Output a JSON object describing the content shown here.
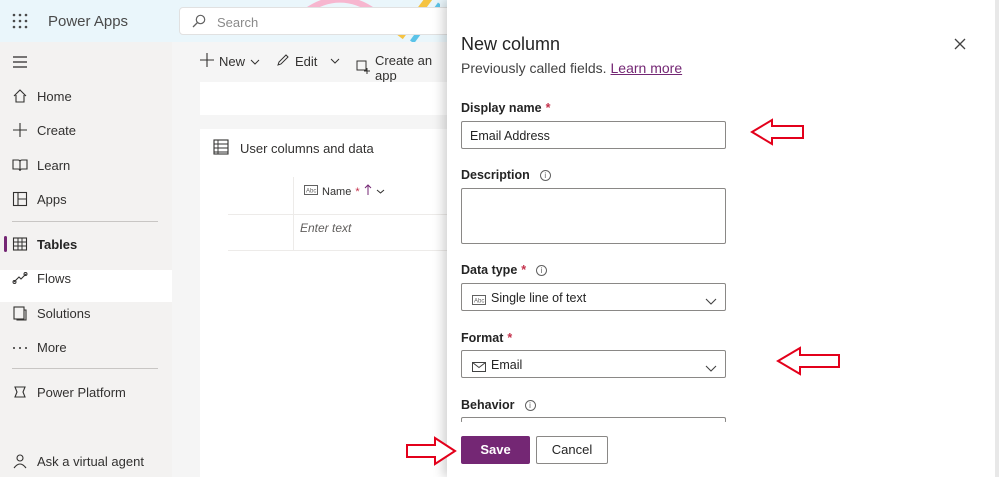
{
  "app": {
    "name": "Power Apps"
  },
  "search": {
    "placeholder": "Search"
  },
  "nav": {
    "items": [
      {
        "label": "Home",
        "icon": "home-icon"
      },
      {
        "label": "Create",
        "icon": "plus-icon"
      },
      {
        "label": "Learn",
        "icon": "book-icon"
      },
      {
        "label": "Apps",
        "icon": "apps-icon"
      },
      {
        "label": "Tables",
        "icon": "table-icon",
        "active": true
      },
      {
        "label": "Flows",
        "icon": "flow-icon"
      },
      {
        "label": "Solutions",
        "icon": "solutions-icon"
      },
      {
        "label": "More",
        "icon": "more-icon"
      },
      {
        "label": "Power Platform",
        "icon": "power-platform-icon"
      },
      {
        "label": "Ask a virtual agent",
        "icon": "agent-icon"
      }
    ]
  },
  "commandbar": {
    "new_label": "New",
    "edit_label": "Edit",
    "create_app_label": "Create an app"
  },
  "table_card": {
    "title": "User columns and data",
    "column_header": "Name",
    "cell_placeholder": "Enter text"
  },
  "panel": {
    "title": "New column",
    "subtitle": "Previously called fields.",
    "learn_more": "Learn more",
    "display_name": {
      "label": "Display name",
      "value": "Email Address"
    },
    "description": {
      "label": "Description",
      "value": ""
    },
    "data_type": {
      "label": "Data type",
      "value": "Single line of text"
    },
    "format": {
      "label": "Format",
      "value": "Email"
    },
    "behavior": {
      "label": "Behavior"
    },
    "save_label": "Save",
    "cancel_label": "Cancel"
  },
  "colors": {
    "accent": "#742774",
    "annotation_arrow": "#e3001b",
    "topbar": "#eaf6fb"
  }
}
